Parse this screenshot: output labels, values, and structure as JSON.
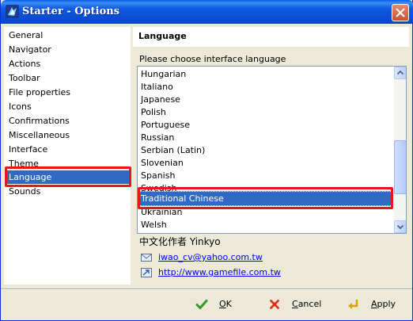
{
  "window": {
    "title": "Starter - Options",
    "colors": {
      "titlebar": "#0a4fd6",
      "selection": "#316ac5",
      "highlight_outline": "#e8151b",
      "link": "#0000ee"
    }
  },
  "nav": {
    "items": [
      {
        "label": "General"
      },
      {
        "label": "Navigator"
      },
      {
        "label": "Actions"
      },
      {
        "label": "Toolbar"
      },
      {
        "label": "File properties"
      },
      {
        "label": "Icons"
      },
      {
        "label": "Confirmations"
      },
      {
        "label": "Miscellaneous"
      },
      {
        "label": "Interface"
      },
      {
        "label": "Theme"
      },
      {
        "label": "Language"
      },
      {
        "label": "Sounds"
      }
    ],
    "selected": "Language"
  },
  "panel": {
    "title": "Language",
    "prompt": "Please choose interface language",
    "languages": [
      "Hungarian",
      "Italiano",
      "Japanese",
      "Polish",
      "Portuguese",
      "Russian",
      "Serbian (Latin)",
      "Slovenian",
      "Spanish",
      "Swedish",
      "Traditional Chinese",
      "Ukrainian",
      "Welsh"
    ],
    "selected_language": "Traditional Chinese",
    "author": "中文化作者 Yinkyo",
    "email": "iwao_cv@yahoo.com.tw",
    "website": "http://www.gamefile.com.tw"
  },
  "buttons": {
    "ok": {
      "mnemonic": "O",
      "rest": "K",
      "icon": "check-icon"
    },
    "cancel": {
      "mnemonic": "C",
      "rest": "ancel",
      "icon": "x-icon"
    },
    "apply": {
      "mnemonic": "A",
      "rest": "pply",
      "icon": "apply-arrow-icon"
    }
  }
}
